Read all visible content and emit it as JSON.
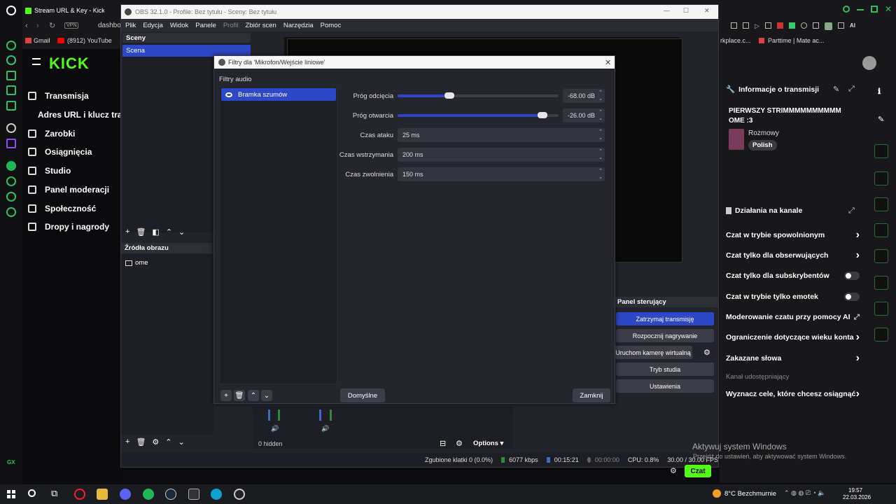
{
  "browser": {
    "tab_title": "Stream URL & Key - Kick D",
    "address_short": "dashbo",
    "bookmarks": [
      "Gmail",
      "(8912) YouTube"
    ],
    "bookmarks_right": [
      "rkplace.c...",
      "Parttime | Mate ac..."
    ],
    "ai_label": "AI"
  },
  "kick": {
    "logo": "KICK",
    "nav": [
      {
        "label": "Transmisja",
        "icon": "broadcast-icon"
      },
      {
        "label": "Adres URL i klucz trans",
        "icon": ""
      },
      {
        "label": "Zarobki",
        "icon": "wallet-icon"
      },
      {
        "label": "Osiągnięcia",
        "icon": "trophy-icon"
      },
      {
        "label": "Studio",
        "icon": "studio-icon"
      },
      {
        "label": "Panel moderacji",
        "icon": "wrench-icon"
      },
      {
        "label": "Społeczność",
        "icon": "people-icon"
      },
      {
        "label": "Dropy i nagrody",
        "icon": "gift-icon"
      }
    ],
    "stream_info": {
      "header": "Informacje o transmisji",
      "title": "PIERWSZY STRIMMMMMMMMMM OME :3",
      "category": "Rozmowy",
      "tag": "Polish"
    },
    "channel_actions": {
      "header": "Działania na kanale",
      "items": [
        {
          "label": "Czat w trybie spowolnionym",
          "kind": "arrow"
        },
        {
          "label": "Czat tylko dla obserwujących",
          "kind": "arrow"
        },
        {
          "label": "Czat tylko dla subskrybentów",
          "kind": "toggle"
        },
        {
          "label": "Czat w trybie tylko emotek",
          "kind": "toggle"
        },
        {
          "label": "Moderowanie czatu przy pomocy AI",
          "kind": "external"
        },
        {
          "label": "Ograniczenie dotyczące wieku konta",
          "kind": "arrow"
        },
        {
          "label": "Zakazane słowa",
          "kind": "arrow"
        },
        {
          "label": "Kanał udostępniający",
          "kind": "none"
        },
        {
          "label": "Wyznacz cele, które chcesz osiągnąć",
          "kind": "arrow"
        }
      ]
    },
    "chat_button": "Czat"
  },
  "obs": {
    "title": "OBS 32.1.0 - Profile: Bez tytułu - Sceny: Bez tytułu",
    "menu": [
      "Plik",
      "Edycja",
      "Widok",
      "Panele",
      "Profil",
      "Zbiór scen",
      "Narzędzia",
      "Pomoc"
    ],
    "scenes_header": "Sceny",
    "scenes": [
      "Scena"
    ],
    "sources_header": "Źródła obrazu",
    "sources": [
      "ome"
    ],
    "controls_header": "Panel sterujący",
    "controls": [
      "Zatrzymaj transmisję",
      "Rozpocznij nagrywanie",
      "Uruchom kamerę wirtualną",
      "Tryb studia",
      "Ustawienia"
    ],
    "hidden_label": "0 hidden",
    "options_label": "Options",
    "status": {
      "dropped": "Zgubione klatki 0 (0.0%)",
      "bitrate": "6077 kbps",
      "stream_time": "00:15:21",
      "rec_time": "00:00:00",
      "cpu": "CPU: 0.8%",
      "fps": "30.00 / 30.00 FPS"
    }
  },
  "dialog": {
    "title": "Filtry dla 'Mikrofon/Wejście liniowe'",
    "section": "Filtry audio",
    "filters": [
      "Bramka szumów"
    ],
    "props": [
      {
        "label": "Próg odcięcia",
        "value": "-68.00 dB",
        "slider_frac": 0.32
      },
      {
        "label": "Próg otwarcia",
        "value": "-26.00 dB",
        "slider_frac": 0.9
      },
      {
        "label": "Czas ataku",
        "value": "25 ms"
      },
      {
        "label": "Czas wstrzymania",
        "value": "200 ms"
      },
      {
        "label": "Czas zwolnienia",
        "value": "150 ms"
      }
    ],
    "defaults_button": "Domyślne",
    "close_button": "Zamknij"
  },
  "watermark": {
    "title": "Aktywuj system Windows",
    "subtitle": "Przejdź do ustawień, aby aktywować system Windows."
  },
  "taskbar": {
    "weather": "8°C Bezchmurnie",
    "time": "19:57",
    "date": "22.03.2026"
  },
  "colors": {
    "kick_green": "#53fc18",
    "obs_accent": "#2d48c6",
    "opera_red": "#ff1b2d"
  }
}
